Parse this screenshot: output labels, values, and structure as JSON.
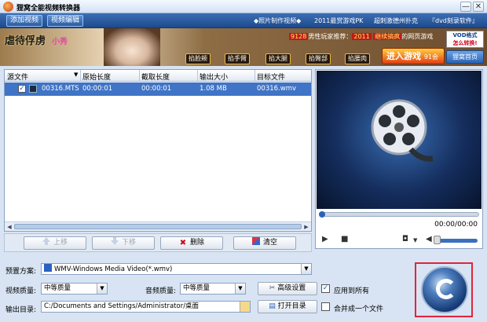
{
  "window": {
    "title": "狸窝全能视频转换器",
    "min_glyph": "—",
    "close_glyph": "✕"
  },
  "toolbar": {
    "add_video": "添加视频",
    "edit_video": "视频编辑",
    "links": [
      "◆照片制作视频◆",
      "2011最赏游戏PK",
      "超刺激德州扑克",
      "『dvd刻录软件』"
    ]
  },
  "banner": {
    "logo": "虐待俘虏",
    "logo_name": "小秀",
    "promo_num1": "9128",
    "promo_text1": "男性玩家推荐：",
    "promo_num2": "2011",
    "promo_red": "继续搞疯",
    "promo_text2": "的网页游戏",
    "game_buttons": [
      "掐脸颊",
      "掐手臂",
      "掐大腿",
      "掐臀部",
      "掐腰肉"
    ],
    "enter_game": "进入游戏",
    "enter_sub": "91会联盟",
    "vod_title": "VOD格式",
    "vod_sub": "怎么转换!",
    "visit_btn": "狸窝首页"
  },
  "file_list": {
    "columns": [
      "源文件",
      "原始长度",
      "截取长度",
      "输出大小",
      "目标文件"
    ],
    "rows": [
      {
        "checked": true,
        "source": "00316.MTS",
        "original": "00:00:01",
        "clip": "00:00:01",
        "size": "1.08 MB",
        "target": "00316.wmv"
      }
    ]
  },
  "actions": {
    "up": "上移",
    "down": "下移",
    "delete": "删除",
    "clear": "清空"
  },
  "player": {
    "time": "00:00/00:00",
    "seek_fraction": 0,
    "volume_fraction": 0.75
  },
  "settings": {
    "preset_label": "预置方案:",
    "preset_value": "WMV-Windows Media Video(*.wmv)",
    "video_quality_label": "视频质量:",
    "video_quality_value": "中等质量",
    "audio_quality_label": "音频质量:",
    "audio_quality_value": "中等质量",
    "advanced": "高级设置",
    "apply_all": "应用到所有",
    "apply_all_checked": true,
    "output_label": "输出目录:",
    "output_path": "C:/Documents and Settings/Administrator/桌面",
    "open_dir": "打开目录",
    "merge": "合并成一个文件",
    "merge_checked": false
  },
  "colors": {
    "toolbar": "#2a5ca3",
    "selected_row": "#3f74c6",
    "convert_border": "#e0243a"
  },
  "icons": [
    "app-icon",
    "film-icon",
    "up-arrow-icon",
    "down-arrow-icon",
    "delete-icon",
    "clear-icon",
    "play-icon",
    "stop-icon",
    "camera-icon",
    "volume-icon",
    "wmv-icon",
    "settings-icon",
    "folder-icon",
    "convert-icon",
    "film-reel-icon"
  ]
}
